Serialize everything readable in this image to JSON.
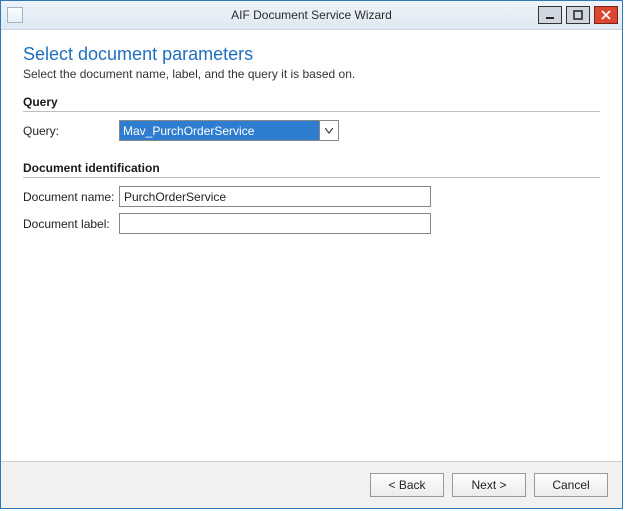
{
  "window": {
    "title": "AIF Document Service Wizard"
  },
  "page": {
    "title": "Select document parameters",
    "subtitle": "Select the document name, label, and the query it is based on."
  },
  "sections": {
    "query": {
      "header": "Query",
      "field_label": "Query:",
      "value": "Mav_PurchOrderService"
    },
    "doc_id": {
      "header": "Document identification",
      "name_label": "Document name:",
      "name_value": "PurchOrderService",
      "label_label": "Document label:",
      "label_value": ""
    }
  },
  "buttons": {
    "back": "< Back",
    "next": "Next >",
    "cancel": "Cancel"
  }
}
